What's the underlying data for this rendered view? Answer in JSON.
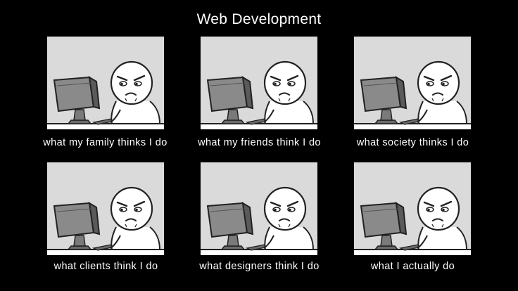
{
  "title": "Web Development",
  "colors": {
    "background": "#000000",
    "panel": "#dadada",
    "text": "#ffffff"
  },
  "panels": [
    {
      "caption": "what my family thinks I do",
      "icon": "guy-at-computer-icon"
    },
    {
      "caption": "what my friends think I do",
      "icon": "guy-at-computer-icon"
    },
    {
      "caption": "what society thinks I do",
      "icon": "guy-at-computer-icon"
    },
    {
      "caption": "what clients think I do",
      "icon": "guy-at-computer-icon"
    },
    {
      "caption": "what designers think I do",
      "icon": "guy-at-computer-icon"
    },
    {
      "caption": "what I actually do",
      "icon": "guy-at-computer-icon"
    }
  ]
}
